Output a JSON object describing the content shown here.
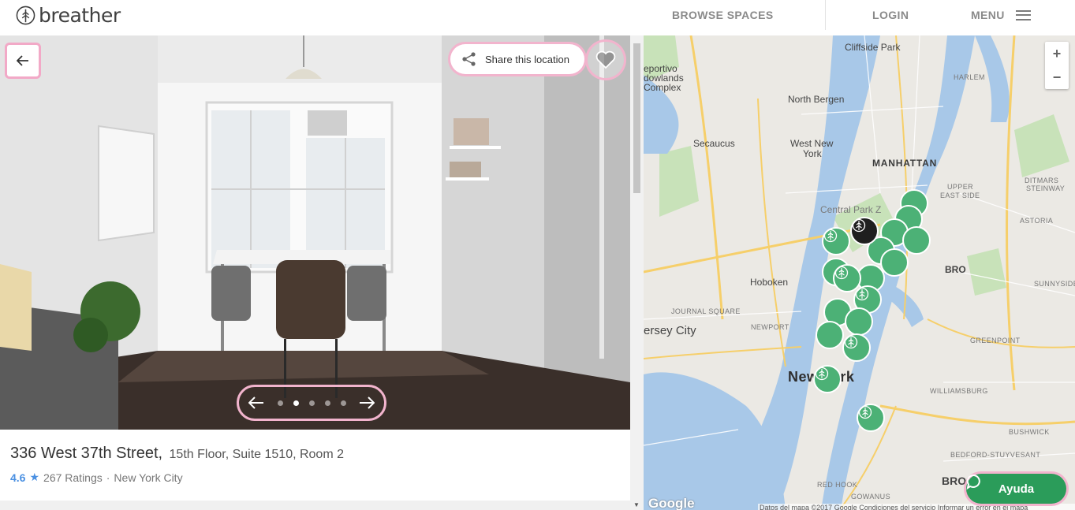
{
  "header": {
    "brand": "breather",
    "nav": {
      "browse": "BROWSE SPACES",
      "login": "LOGIN",
      "menu": "MENU"
    }
  },
  "photo": {
    "share_label": "Share this location",
    "dot_count": 5,
    "active_dot_index": 1
  },
  "listing": {
    "street": "336 West 37th Street,",
    "unit": "15th Floor, Suite 1510, Room 2",
    "rating": "4.6",
    "ratings_count": "267 Ratings",
    "separator": "·",
    "city": "New York City"
  },
  "map": {
    "zoom_in": "+",
    "zoom_out": "−",
    "labels": {
      "cliffside_park": "Cliffside Park",
      "north_bergen": "North Bergen",
      "secaucus": "Secaucus",
      "west_new_york_1": "West New",
      "west_new_york_2": "York",
      "manhattan": "MANHATTAN",
      "harlem": "HARLEM",
      "upper_east_side_1": "UPPER",
      "upper_east_side_2": "EAST SIDE",
      "central_park": "Central Park Z",
      "hoboken": "Hoboken",
      "jersey_city": "ersey City",
      "new_york": "New York",
      "astoria": "ASTORIA",
      "sunnyside": "SUNNYSIDE",
      "greenpoint": "GREENPOINT",
      "williamsburg": "WILLIAMSBURG",
      "bushwick": "BUSHWICK",
      "bed_stuy": "BEDFORD-STUYVESANT",
      "red_hook": "RED HOOK",
      "gowanus": "GOWANUS",
      "newport": "NEWPORT",
      "journal_square": "JOURNAL SQUARE",
      "ditmars_1": "DITMARS",
      "ditmars_2": "STEINWAY",
      "meadowlands_1": "eportivo",
      "meadowlands_2": "dowlands",
      "meadowlands_3": "Complex",
      "bro_1": "BRO",
      "bro_2": "BRO"
    },
    "google": "Google",
    "attribution": "Datos del mapa ©2017 Google   Condiciones del servicio   Informar un error en el mapa",
    "help_label": "Ayuda"
  },
  "colors": {
    "accent_pin": "#4cb176",
    "help_button": "#2b9c5a",
    "rating_blue": "#4a90e2",
    "annotation_pink": "#f2b4cd"
  }
}
